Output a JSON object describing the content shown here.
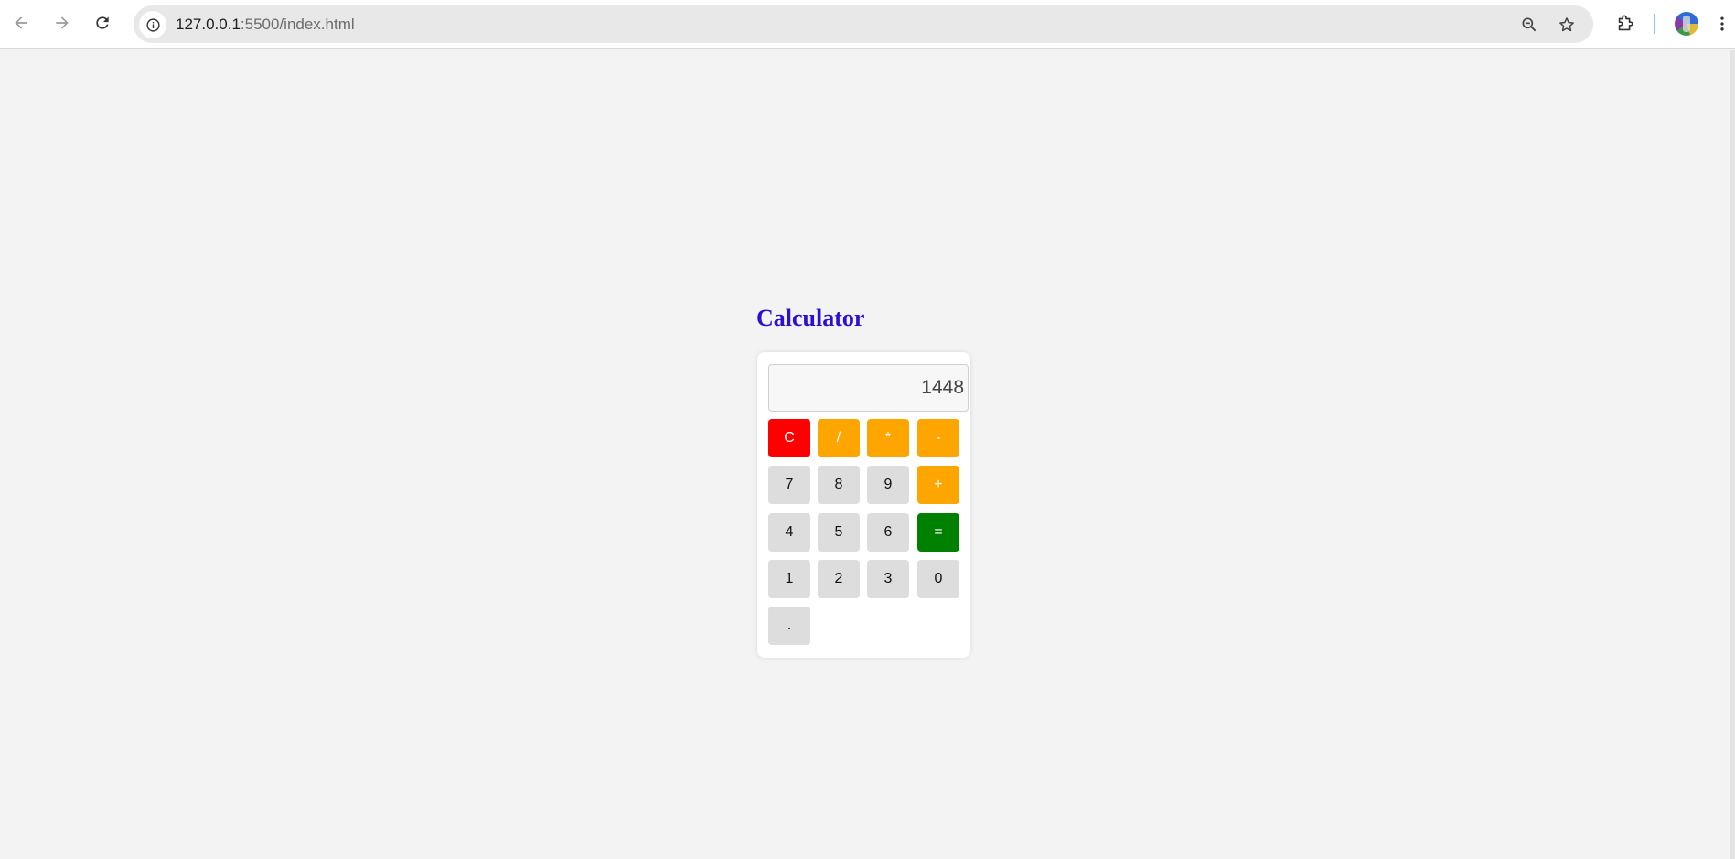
{
  "browser": {
    "url_host": "127.0.0.1",
    "url_path": ":5500/index.html",
    "icons": [
      "back-arrow-icon",
      "forward-arrow-icon",
      "reload-icon",
      "info-icon",
      "zoom-out-icon",
      "star-icon",
      "extensions-puzzle-icon",
      "avatar",
      "kebab-menu-icon"
    ]
  },
  "calculator": {
    "title": "Calculator",
    "display_value": "1448",
    "keys": {
      "clear": "C",
      "divide": "/",
      "multiply": "*",
      "subtract": "-",
      "seven": "7",
      "eight": "8",
      "nine": "9",
      "add": "+",
      "four": "4",
      "five": "5",
      "six": "6",
      "equals": "=",
      "one": "1",
      "two": "2",
      "three": "3",
      "zero": "0",
      "decimal": "."
    }
  },
  "colors": {
    "title": "#2c0fd4",
    "clear_key": "#ff0000",
    "operator_key": "#ffa500",
    "equals_key": "#008000",
    "digit_key": "#dddddd",
    "page_background": "#f3f3f3"
  }
}
